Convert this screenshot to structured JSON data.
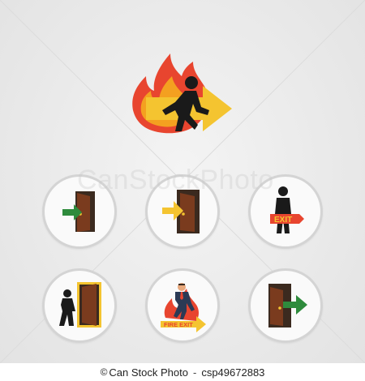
{
  "icons": {
    "hero": "fire-exit-running-man-icon",
    "items": [
      {
        "name": "door-enter-arrow-icon"
      },
      {
        "name": "arrow-into-door-icon"
      },
      {
        "name": "man-holding-exit-sign-icon",
        "label": "EXIT"
      },
      {
        "name": "man-walking-to-door-icon"
      },
      {
        "name": "fire-exit-man-icon",
        "label": "FIRE EXIT"
      },
      {
        "name": "door-exit-arrow-icon"
      }
    ]
  },
  "watermark": {
    "text": "CanStockPhoto"
  },
  "footer": {
    "copyright_symbol": "©",
    "brand": "Can Stock Photo",
    "image_id": "csp49672883"
  },
  "colors": {
    "flame_red": "#e8452f",
    "flame_orange": "#f4a020",
    "arrow_yellow": "#f4c430",
    "silhouette": "#1a1a1a",
    "door_brown": "#7a3b1e",
    "door_frame": "#3b2a1f",
    "arrow_green": "#2e8b3c",
    "circle_border": "#d4d4d4"
  }
}
